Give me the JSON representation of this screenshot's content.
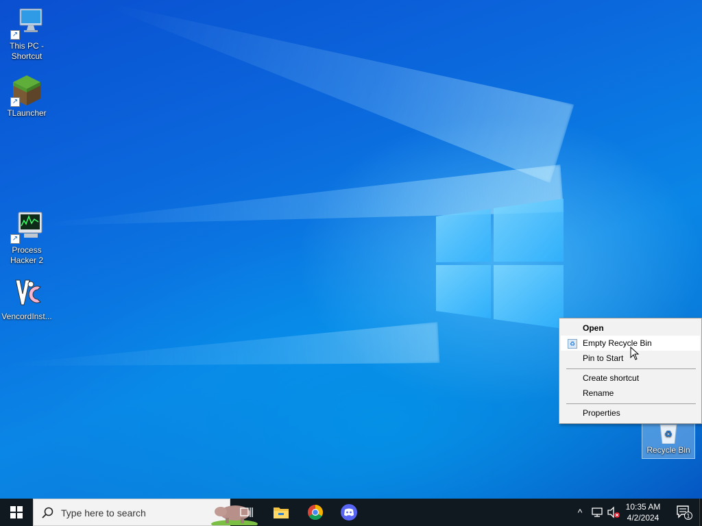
{
  "desktop": {
    "icons": [
      {
        "label_line1": "This PC -",
        "label_line2": "Shortcut",
        "icon": "monitor-icon"
      },
      {
        "label_line1": "TLauncher",
        "label_line2": "",
        "icon": "grass-block-icon"
      },
      {
        "label_line1": "Process",
        "label_line2": "Hacker 2",
        "icon": "process-hacker-icon"
      },
      {
        "label_line1": "VencordInst...",
        "label_line2": "",
        "icon": "vencord-icon"
      },
      {
        "label_line1": "Recycle Bin",
        "label_line2": "",
        "icon": "recycle-bin-icon"
      }
    ]
  },
  "context_menu": {
    "items": [
      {
        "label": "Open"
      },
      {
        "label": "Empty Recycle Bin"
      },
      {
        "label": "Pin to Start"
      },
      {
        "label": "Create shortcut"
      },
      {
        "label": "Rename"
      },
      {
        "label": "Properties"
      }
    ]
  },
  "taskbar": {
    "search_placeholder": "Type here to search",
    "time": "10:35 AM",
    "date": "4/2/2024",
    "notification_count": "1"
  },
  "colors": {
    "taskbar": "#101820",
    "wallpaper_accent": "#0a78e0",
    "menu_bg": "#f2f2f2"
  }
}
